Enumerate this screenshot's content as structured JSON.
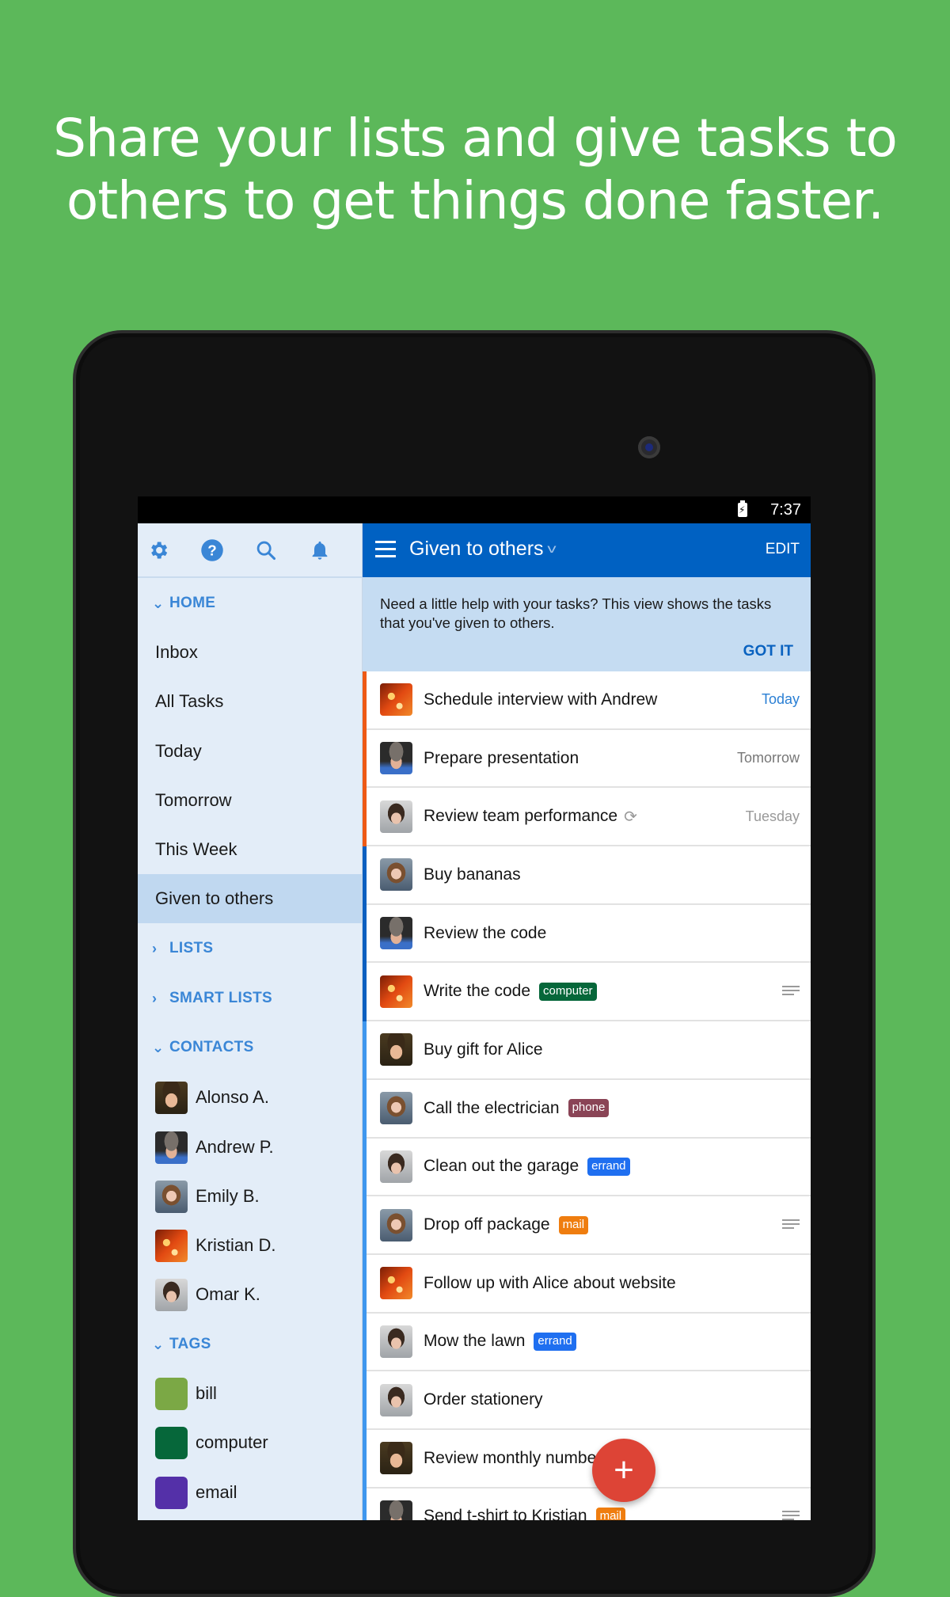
{
  "headline": {
    "line1": "Share your lists and give tasks to",
    "line2": "others to get things done faster."
  },
  "status_bar": {
    "time": "7:37",
    "battery_icon": "battery-charging-icon"
  },
  "sidebar": {
    "toolbar_icons": [
      "gear-icon",
      "help-icon",
      "search-icon",
      "bell-icon"
    ],
    "home": {
      "label": "HOME",
      "items": [
        {
          "label": "Inbox"
        },
        {
          "label": "All Tasks"
        },
        {
          "label": "Today"
        },
        {
          "label": "Tomorrow"
        },
        {
          "label": "This Week"
        },
        {
          "label": "Given to others",
          "active": true
        }
      ]
    },
    "lists_label": "LISTS",
    "smart_lists_label": "SMART LISTS",
    "contacts": {
      "label": "CONTACTS",
      "items": [
        {
          "name": "Alonso A."
        },
        {
          "name": "Andrew P."
        },
        {
          "name": "Emily B."
        },
        {
          "name": "Kristian D."
        },
        {
          "name": "Omar K."
        }
      ]
    },
    "tags": {
      "label": "TAGS",
      "items": [
        {
          "name": "bill",
          "color": "#7ba845"
        },
        {
          "name": "computer",
          "color": "#06673a"
        },
        {
          "name": "email",
          "color": "#5430a8"
        }
      ]
    }
  },
  "main": {
    "title": "Given to others",
    "edit_label": "EDIT",
    "banner": {
      "text": "Need a little help with your tasks? This view shows the tasks that you've given to others.",
      "action": "GOT IT"
    },
    "tasks": [
      {
        "title": "Schedule interview with Andrew",
        "assignee": "Kristian D.",
        "due": "Today",
        "due_color": "#2a7fd4",
        "priority_color": "#ee5a16"
      },
      {
        "title": "Prepare presentation",
        "assignee": "Andrew P.",
        "due": "Tomorrow",
        "due_color": "#777777",
        "priority_color": "#ee5a16"
      },
      {
        "title": "Review team performance",
        "assignee": "Omar K.",
        "due": "Tuesday",
        "due_color": "#999999",
        "repeat": true,
        "priority_color": "#ee5a16"
      },
      {
        "title": "Buy bananas",
        "assignee": "Emily B.",
        "priority_color": "#0b5fc0"
      },
      {
        "title": "Review the code",
        "assignee": "Andrew P.",
        "priority_color": "#0b5fc0"
      },
      {
        "title": "Write the code",
        "assignee": "Kristian D.",
        "tag": "computer",
        "tag_color": "#06673a",
        "has_note": true,
        "priority_color": "#0b5fc0"
      },
      {
        "title": "Buy gift for Alice",
        "assignee": "Alonso A.",
        "priority_color": "#3f97ee"
      },
      {
        "title": "Call the electrician",
        "assignee": "Emily B.",
        "tag": "phone",
        "tag_color": "#8a4456",
        "priority_color": "#3f97ee"
      },
      {
        "title": "Clean out the garage",
        "assignee": "Omar K.",
        "tag": "errand",
        "tag_color": "#1f6ff0",
        "priority_color": "#3f97ee"
      },
      {
        "title": "Drop off package",
        "assignee": "Emily B.",
        "tag": "mail",
        "tag_color": "#ef7d0f",
        "has_note": true,
        "priority_color": "#3f97ee"
      },
      {
        "title": "Follow up with Alice about website",
        "assignee": "Kristian D.",
        "priority_color": "#3f97ee"
      },
      {
        "title": "Mow the lawn",
        "assignee": "Omar K.",
        "tag": "errand",
        "tag_color": "#1f6ff0",
        "priority_color": "#3f97ee"
      },
      {
        "title": "Order stationery",
        "assignee": "Omar K.",
        "priority_color": "#3f97ee"
      },
      {
        "title": "Review monthly numbers",
        "assignee": "Alonso A.",
        "priority_color": "#3f97ee"
      },
      {
        "title": "Send t-shirt to Kristian",
        "assignee": "Andrew P.",
        "tag": "mail",
        "tag_color": "#ef7d0f",
        "has_note": true,
        "priority_color": "#3f97ee"
      }
    ],
    "fab_label": "+"
  }
}
